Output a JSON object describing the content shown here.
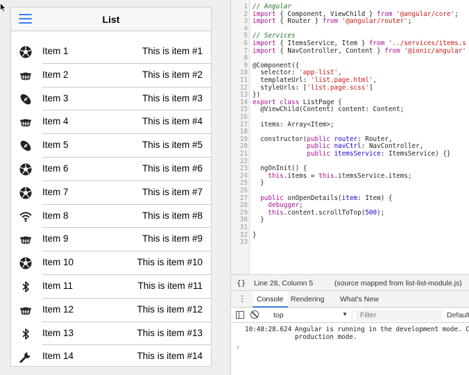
{
  "app": {
    "title": "List",
    "items": [
      {
        "title": "Item 1",
        "note": "This is item #1",
        "icon": "football-icon"
      },
      {
        "title": "Item 2",
        "note": "This is item #2",
        "icon": "basketball-icon"
      },
      {
        "title": "Item 3",
        "note": "This is item #3",
        "icon": "american-football-icon"
      },
      {
        "title": "Item 4",
        "note": "This is item #4",
        "icon": "basketball-icon"
      },
      {
        "title": "Item 5",
        "note": "This is item #5",
        "icon": "american-football-icon"
      },
      {
        "title": "Item 6",
        "note": "This is item #6",
        "icon": "football-icon"
      },
      {
        "title": "Item 7",
        "note": "This is item #7",
        "icon": "football-icon"
      },
      {
        "title": "Item 8",
        "note": "This is item #8",
        "icon": "wifi-icon"
      },
      {
        "title": "Item 9",
        "note": "This is item #9",
        "icon": "basketball-icon"
      },
      {
        "title": "Item 10",
        "note": "This is item #10",
        "icon": "football-icon"
      },
      {
        "title": "Item 11",
        "note": "This is item #11",
        "icon": "bluetooth-icon"
      },
      {
        "title": "Item 12",
        "note": "This is item #12",
        "icon": "basketball-icon"
      },
      {
        "title": "Item 13",
        "note": "This is item #13",
        "icon": "bluetooth-icon"
      },
      {
        "title": "Item 14",
        "note": "This is item #14",
        "icon": "build-icon"
      }
    ]
  },
  "editor": {
    "lines": [
      {
        "n": "1",
        "html": "<span class=\"c\">// Angular</span>"
      },
      {
        "n": "2",
        "html": "<span class=\"k\">import</span> { Component, ViewChild } <span class=\"k\">from</span> <span class=\"s\">'@angular/core'</span>;"
      },
      {
        "n": "3",
        "html": "<span class=\"k\">import</span> { Router } <span class=\"k\">from</span> <span class=\"s\">'@angular/router'</span>;"
      },
      {
        "n": "4",
        "html": ""
      },
      {
        "n": "5",
        "html": "<span class=\"c\">// Services</span>"
      },
      {
        "n": "6",
        "html": "<span class=\"k\">import</span> { ItemsService, Item } <span class=\"k\">from</span> <span class=\"s\">'../services/items.s</span>"
      },
      {
        "n": "7",
        "html": "<span class=\"k\">import</span> { NavController, Content } <span class=\"k\">from</span> <span class=\"s\">'@ionic/angular'</span>"
      },
      {
        "n": "8",
        "html": ""
      },
      {
        "n": "9",
        "html": "@Component({"
      },
      {
        "n": "10",
        "html": "  selector: <span class=\"s\">'app-list'</span>,"
      },
      {
        "n": "11",
        "html": "  templateUrl: <span class=\"s\">'list.page.html'</span>,"
      },
      {
        "n": "12",
        "html": "  styleUrls: [<span class=\"s\">'list.page.scss'</span>]"
      },
      {
        "n": "13",
        "html": "})"
      },
      {
        "n": "14",
        "html": "<span class=\"k\">export class</span> ListPage {"
      },
      {
        "n": "15",
        "html": "  @ViewChild(Content) content: Content;"
      },
      {
        "n": "16",
        "html": ""
      },
      {
        "n": "17",
        "html": "  items: Array&lt;Item&gt;;"
      },
      {
        "n": "18",
        "html": ""
      },
      {
        "n": "19",
        "html": "  constructor(<span class=\"k\">public</span> <span class=\"t\">router</span>: Router,"
      },
      {
        "n": "20",
        "html": "              <span class=\"k\">public</span> <span class=\"t\">navCtrl</span>: NavController,"
      },
      {
        "n": "21",
        "html": "              <span class=\"k\">public</span> <span class=\"t\">itemsService</span>: ItemsService) {}"
      },
      {
        "n": "22",
        "html": ""
      },
      {
        "n": "23",
        "html": "  ngOnInit() {"
      },
      {
        "n": "24",
        "html": "    <span class=\"k\">this</span>.items = <span class=\"k\">this</span>.itemsService.items;"
      },
      {
        "n": "25",
        "html": "  }"
      },
      {
        "n": "26",
        "html": ""
      },
      {
        "n": "27",
        "html": "  <span class=\"k\">public</span> onOpenDetails(<span class=\"t\">item</span>: Item) {"
      },
      {
        "n": "28",
        "html": "    <span class=\"k\">debugger</span>;"
      },
      {
        "n": "29",
        "html": "    <span class=\"k\">this</span>.content.scrollToTop(<span class=\"n\">500</span>);"
      },
      {
        "n": "30",
        "html": "  }"
      },
      {
        "n": "31",
        "html": ""
      },
      {
        "n": "32",
        "html": "}"
      },
      {
        "n": "33",
        "html": ""
      }
    ]
  },
  "status": {
    "brace": "{}",
    "cursor": "Line 28, Column 5",
    "source": "(source mapped from list-list-module.js)"
  },
  "drawer": {
    "tabs": [
      "Console",
      "Rendering",
      "What's New"
    ],
    "menu": "⋮"
  },
  "console": {
    "context": "top",
    "filter_placeholder": "Filter",
    "levels": "Default",
    "log": {
      "time": "10:48:28.624",
      "message_line1": "Angular is running in the development mode. C",
      "message_line2": "production mode."
    },
    "prompt": "›"
  }
}
